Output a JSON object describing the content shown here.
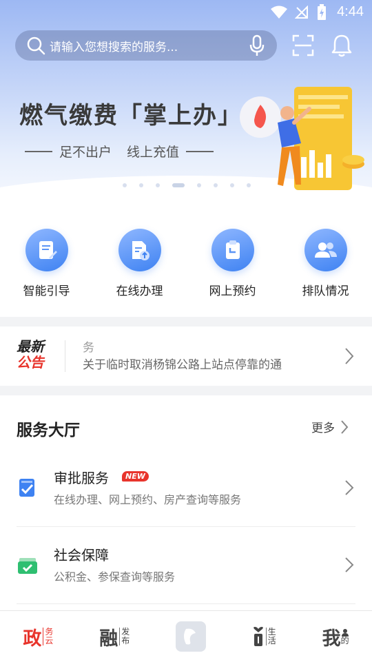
{
  "status": {
    "time": "4:44"
  },
  "search": {
    "placeholder": "请输入您想搜索的服务..."
  },
  "banner": {
    "title": "燃气缴费「掌上办」",
    "subtitle_left": "足不出户",
    "subtitle_right": "线上充值",
    "slides": 8,
    "active_slide": 4
  },
  "quick_actions": [
    {
      "label": "智能引导",
      "icon": "guide-icon"
    },
    {
      "label": "在线办理",
      "icon": "document-upload-icon"
    },
    {
      "label": "网上预约",
      "icon": "clipboard-icon"
    },
    {
      "label": "排队情况",
      "icon": "people-icon"
    }
  ],
  "notice": {
    "logo_line1": "最新",
    "logo_line2": "公告",
    "prev_item": "务",
    "current_item": "关于临时取消杨锦公路上站点停靠的通"
  },
  "service_hall": {
    "title": "服务大厅",
    "more": "更多",
    "items": [
      {
        "title": "审批服务",
        "badge": "NEW",
        "desc": "在线办理、网上预约、房产查询等服务",
        "icon": "approval-checklist-icon"
      },
      {
        "title": "社会保障",
        "badge": "",
        "desc": "公积金、参保查询等服务",
        "icon": "social-security-card-icon"
      }
    ]
  },
  "tabs": [
    {
      "main": "政",
      "sub1": "务",
      "sub2": "云",
      "active": true
    },
    {
      "main": "融",
      "sub1": "发",
      "sub2": "布",
      "active": false
    },
    {
      "logo": true
    },
    {
      "main": "",
      "sub1": "生",
      "sub2": "活",
      "active": false
    },
    {
      "main": "我",
      "sub1": "",
      "sub2": "的",
      "active": false
    }
  ],
  "colors": {
    "accent": "#3e82f2",
    "red": "#e8342c",
    "green": "#2fbf71"
  }
}
